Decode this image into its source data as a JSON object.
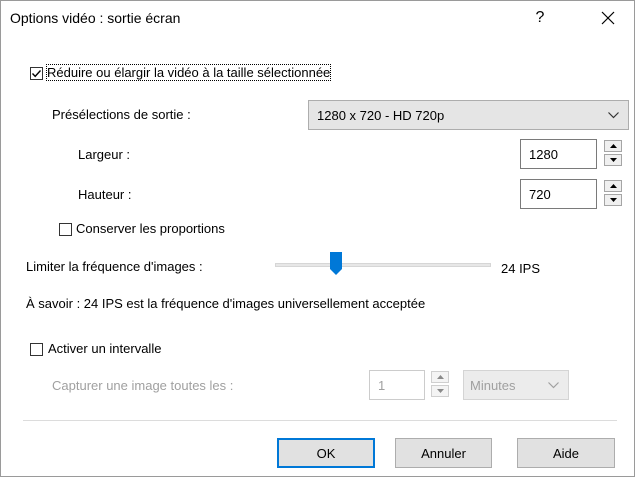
{
  "window": {
    "title": "Options vidéo : sortie écran",
    "help_label": "?"
  },
  "resize": {
    "checkbox_label": "Réduire ou élargir la vidéo à la taille sélectionnée",
    "checked": true
  },
  "presets": {
    "label": "Présélections de sortie :",
    "selected": "1280 x 720 - HD 720p"
  },
  "width": {
    "label": "Largeur :",
    "value": "1280"
  },
  "height": {
    "label": "Hauteur :",
    "value": "720"
  },
  "proportions": {
    "label": "Conserver les proportions",
    "checked": false
  },
  "framerate": {
    "label": "Limiter la fréquence d'images :",
    "value_label": "24 IPS",
    "tip": "À savoir : 24 IPS est la fréquence d'images universellement acceptée"
  },
  "interval": {
    "checkbox_label": "Activer un intervalle",
    "checked": false,
    "capture_label": "Capturer une image toutes les :",
    "value": "1",
    "unit": "Minutes"
  },
  "buttons": {
    "ok": "OK",
    "cancel": "Annuler",
    "help": "Aide"
  }
}
